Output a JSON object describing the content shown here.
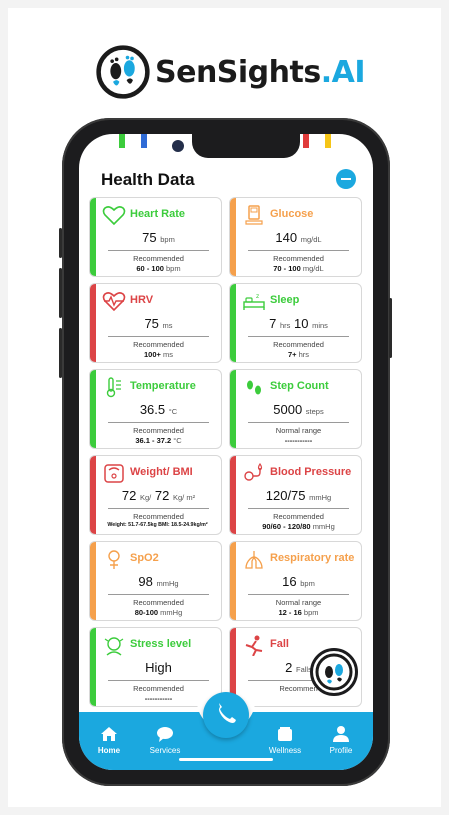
{
  "brand": {
    "name": "SenSights",
    "suffix": ".AI"
  },
  "header": {
    "title": "Health Data"
  },
  "colors": {
    "green": "#3ccc3c",
    "orange": "#f5a04c",
    "red": "#dc4446",
    "blue": "#1ba8df"
  },
  "cards": [
    {
      "name": "Heart Rate",
      "icon": "heart-icon",
      "status": "green",
      "value": "75",
      "unit": "bpm",
      "rec_label": "Recommended",
      "range": "60 - 100",
      "range_unit": "bpm"
    },
    {
      "name": "Glucose",
      "icon": "glucose-meter-icon",
      "status": "orange",
      "value": "140",
      "unit": "mg/dL",
      "rec_label": "Recommended",
      "range": "70 - 100",
      "range_unit": "mg/dL"
    },
    {
      "name": "HRV",
      "icon": "heart-pulse-icon",
      "status": "red",
      "value": "75",
      "unit": "ms",
      "rec_label": "Recommended",
      "range": "100+",
      "range_unit": "ms"
    },
    {
      "name": "Sleep",
      "icon": "bed-icon",
      "status": "green",
      "value": "7",
      "unit": "hrs",
      "value2": "10",
      "unit2": "mins",
      "rec_label": "Recommended",
      "range": "7+",
      "range_unit": "hrs"
    },
    {
      "name": "Temperature",
      "icon": "thermometer-icon",
      "status": "green",
      "value": "36.5",
      "unit": "°C",
      "rec_label": "Recommended",
      "range": "36.1 - 37.2",
      "range_unit": "°C"
    },
    {
      "name": "Step Count",
      "icon": "footsteps-icon",
      "status": "green",
      "value": "5000",
      "unit": "steps",
      "rec_label": "Normal range",
      "range": "-----------",
      "range_unit": ""
    },
    {
      "name": "Weight/ BMI",
      "icon": "scale-icon",
      "status": "red",
      "value": "72",
      "unit": "Kg/",
      "value2": "72",
      "unit2": "Kg/ m²",
      "rec_label": "Recommended",
      "range": "Weight: 51.7-67.5kg BMI: 18.5-24.9kg/m²",
      "range_unit": ""
    },
    {
      "name": "Blood Pressure",
      "icon": "blood-pressure-icon",
      "status": "red",
      "value": "120/75",
      "unit": "mmHg",
      "rec_label": "Recommended",
      "range": "90/60 - 120/80",
      "range_unit": "mmHg"
    },
    {
      "name": "SpO2",
      "icon": "oxygen-icon",
      "status": "orange",
      "value": "98",
      "unit": "mmHg",
      "rec_label": "Recommended",
      "range": "80-100",
      "range_unit": "mmHg"
    },
    {
      "name": "Respiratory rate",
      "icon": "lungs-icon",
      "status": "orange",
      "value": "16",
      "unit": "bpm",
      "rec_label": "Normal range",
      "range": "12 - 16",
      "range_unit": "bpm"
    },
    {
      "name": "Stress level",
      "icon": "stress-icon",
      "status": "green",
      "value": "High",
      "unit": "",
      "rec_label": "Recommended",
      "range": "-----------",
      "range_unit": ""
    },
    {
      "name": "Fall",
      "icon": "fall-icon",
      "status": "red",
      "value": "2",
      "unit": "Falls",
      "rec_label": "Recommen",
      "range": "",
      "range_unit": ""
    }
  ],
  "nav": {
    "items": [
      {
        "label": "Home",
        "icon": "home-icon"
      },
      {
        "label": "Services",
        "icon": "chat-icon"
      },
      {
        "label": "Wellness",
        "icon": "wellness-icon"
      },
      {
        "label": "Profile",
        "icon": "profile-icon"
      }
    ],
    "center": {
      "icon": "phone-icon"
    }
  }
}
